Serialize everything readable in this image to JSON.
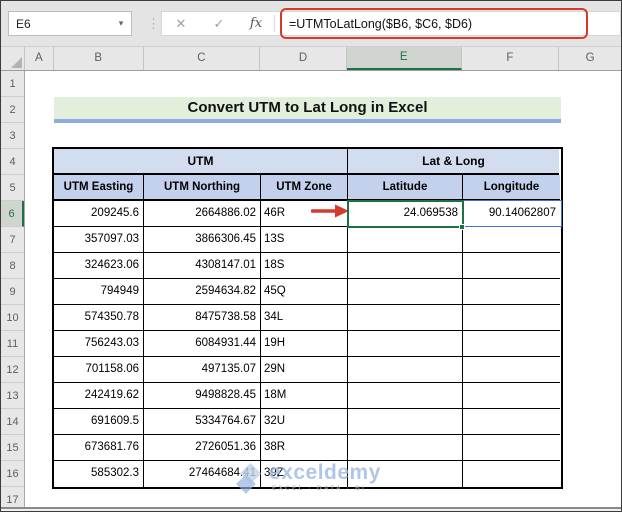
{
  "name_box": {
    "value": "E6"
  },
  "formula_bar": {
    "formula": "=UTMToLatLong($B6, $C6, $D6)"
  },
  "icons": {
    "dropdown": "▾",
    "dots": "⋮",
    "cancel": "✕",
    "enter": "✓",
    "fx": "fx"
  },
  "grid": {
    "column_headers": [
      "A",
      "B",
      "C",
      "D",
      "E",
      "F",
      "G"
    ],
    "row_headers": [
      "1",
      "2",
      "3",
      "4",
      "5",
      "6",
      "7",
      "8",
      "9",
      "10",
      "11",
      "12",
      "13",
      "14",
      "15",
      "16",
      "17"
    ],
    "selected_cell": "E6"
  },
  "title_banner": {
    "text": "Convert UTM to Lat Long in Excel"
  },
  "table": {
    "group_headers": [
      {
        "label": "UTM"
      },
      {
        "label": "Lat & Long"
      }
    ],
    "column_headers": [
      "UTM Easting",
      "UTM Northing",
      "UTM Zone",
      "Latitude",
      "Longitude"
    ],
    "rows": [
      {
        "easting": "209245.6",
        "northing": "2664886.02",
        "zone": "46R",
        "latitude": "24.069538",
        "longitude": "90.14062807"
      },
      {
        "easting": "357097.03",
        "northing": "3866306.45",
        "zone": "13S",
        "latitude": "",
        "longitude": ""
      },
      {
        "easting": "324623.06",
        "northing": "4308147.01",
        "zone": "18S",
        "latitude": "",
        "longitude": ""
      },
      {
        "easting": "794949",
        "northing": "2594634.82",
        "zone": "45Q",
        "latitude": "",
        "longitude": ""
      },
      {
        "easting": "574350.78",
        "northing": "8475738.58",
        "zone": "34L",
        "latitude": "",
        "longitude": ""
      },
      {
        "easting": "756243.03",
        "northing": "6084931.44",
        "zone": "19H",
        "latitude": "",
        "longitude": ""
      },
      {
        "easting": "701158.06",
        "northing": "497135.07",
        "zone": "29N",
        "latitude": "",
        "longitude": ""
      },
      {
        "easting": "242419.62",
        "northing": "9498828.45",
        "zone": "18M",
        "latitude": "",
        "longitude": ""
      },
      {
        "easting": "691609.5",
        "northing": "5334764.67",
        "zone": "32U",
        "latitude": "",
        "longitude": ""
      },
      {
        "easting": "673681.76",
        "northing": "2726051.36",
        "zone": "38R",
        "latitude": "",
        "longitude": ""
      },
      {
        "easting": "585302.3",
        "northing": "27464684.41",
        "zone": "39Z",
        "latitude": "",
        "longitude": ""
      }
    ]
  },
  "watermark": {
    "brand": "exceldemy",
    "tagline": "EXCEL · DATA · BI"
  },
  "colors": {
    "selection_green": "#1e7145",
    "annotation_red": "#d53a2b",
    "group_header_blue": "#d3ddf0",
    "column_header_blue": "#c4d1ec",
    "banner_green": "#e2efda",
    "banner_underline_blue": "#8faadc",
    "result_border_blue": "#4472c4"
  }
}
